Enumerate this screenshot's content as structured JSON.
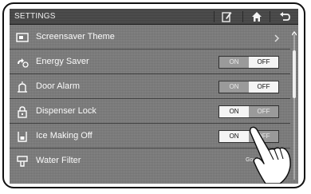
{
  "header": {
    "title": "SETTINGS",
    "icons": [
      "edit-icon",
      "home-icon",
      "back-icon"
    ]
  },
  "rows": [
    {
      "label": "Screensaver Theme",
      "icon": "screensaver-icon"
    },
    {
      "label": "Energy Saver",
      "icon": "energy-saver-icon",
      "toggle": {
        "on": "ON",
        "off": "OFF",
        "state": "OFF"
      }
    },
    {
      "label": "Door Alarm",
      "icon": "door-alarm-icon",
      "toggle": {
        "on": "ON",
        "off": "OFF",
        "state": "OFF"
      }
    },
    {
      "label": "Dispenser Lock",
      "icon": "lock-icon",
      "toggle": {
        "on": "ON",
        "off": "OFF",
        "state": "ON"
      }
    },
    {
      "label": "Ice Making Off",
      "icon": "ice-icon",
      "toggle": {
        "on": "ON",
        "off": "OFF",
        "state": "ON"
      }
    },
    {
      "label": "Water Filter",
      "icon": "water-filter-icon",
      "status": "Good"
    }
  ],
  "colors": {
    "screen": "#7d7d7d",
    "bar": "#505050",
    "text": "#fafafa"
  }
}
